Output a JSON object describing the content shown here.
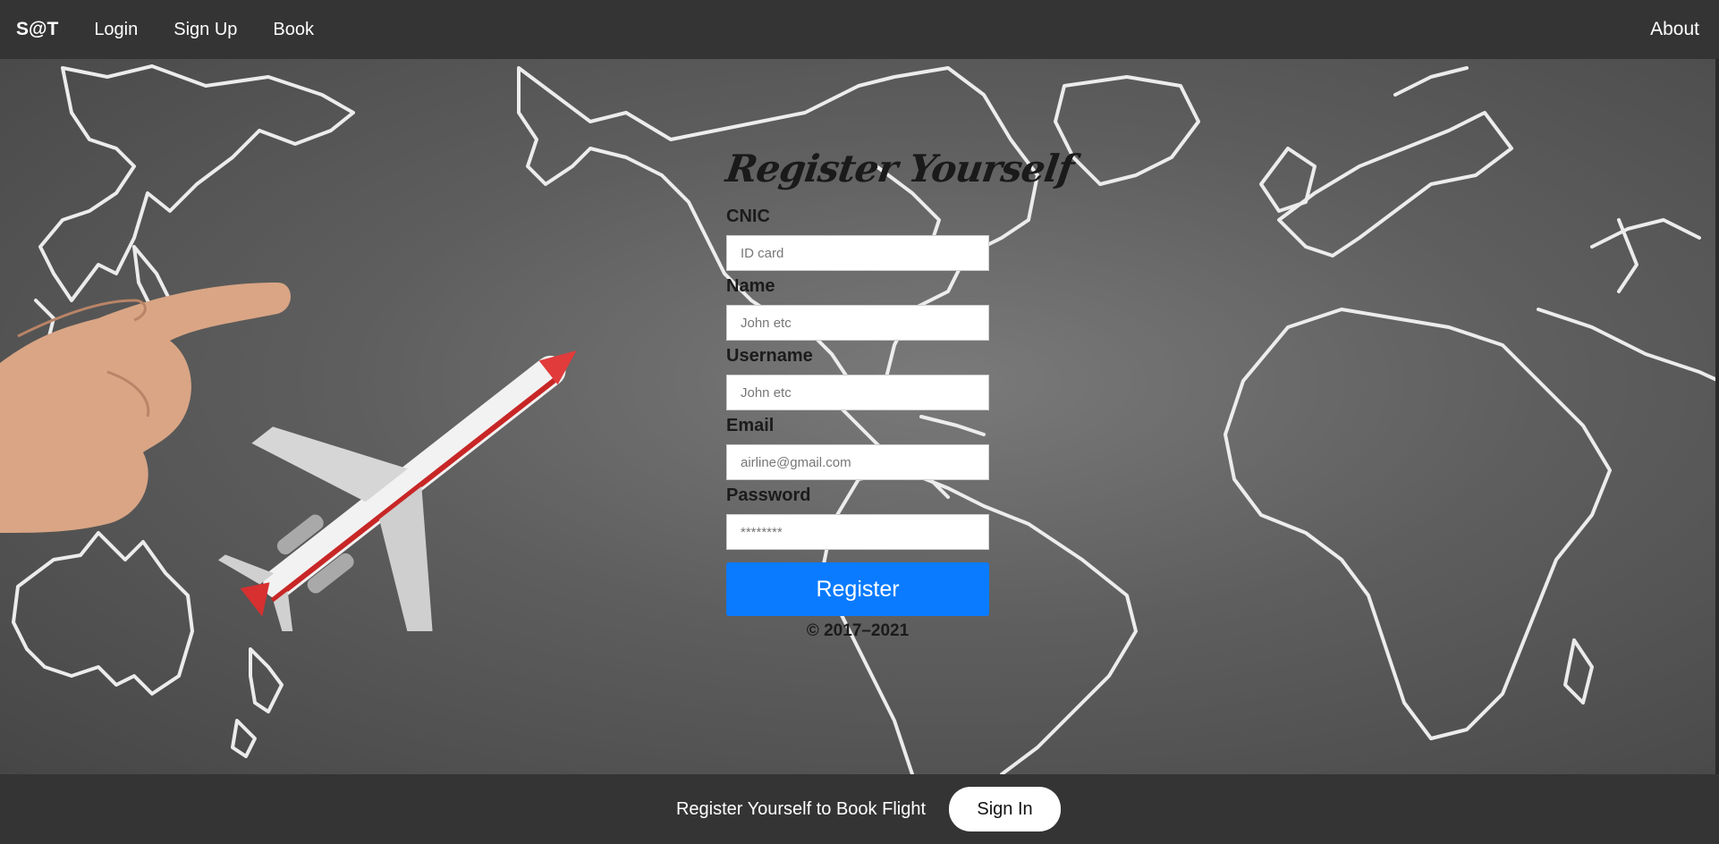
{
  "navbar": {
    "brand": "S@T",
    "links": [
      "Login",
      "Sign Up",
      "Book"
    ],
    "right_link": "About"
  },
  "form": {
    "title": "Register Yourself",
    "fields": [
      {
        "label": "CNIC",
        "placeholder": "ID card"
      },
      {
        "label": "Name",
        "placeholder": "John etc"
      },
      {
        "label": "Username",
        "placeholder": "John etc"
      },
      {
        "label": "Email",
        "placeholder": "airline@gmail.com"
      },
      {
        "label": "Password",
        "placeholder": "********"
      }
    ],
    "submit_label": "Register",
    "copyright": "© 2017–2021"
  },
  "footer": {
    "text": "Register Yourself to Book Flight",
    "button_label": "Sign In"
  },
  "colors": {
    "navbar_bg": "#343434",
    "primary": "#0a7bff",
    "chalkboard": "#5e5e5e"
  },
  "background_icons": [
    "world-map-chalk-outline",
    "hand-pointing-icon",
    "airplane-model-icon"
  ]
}
